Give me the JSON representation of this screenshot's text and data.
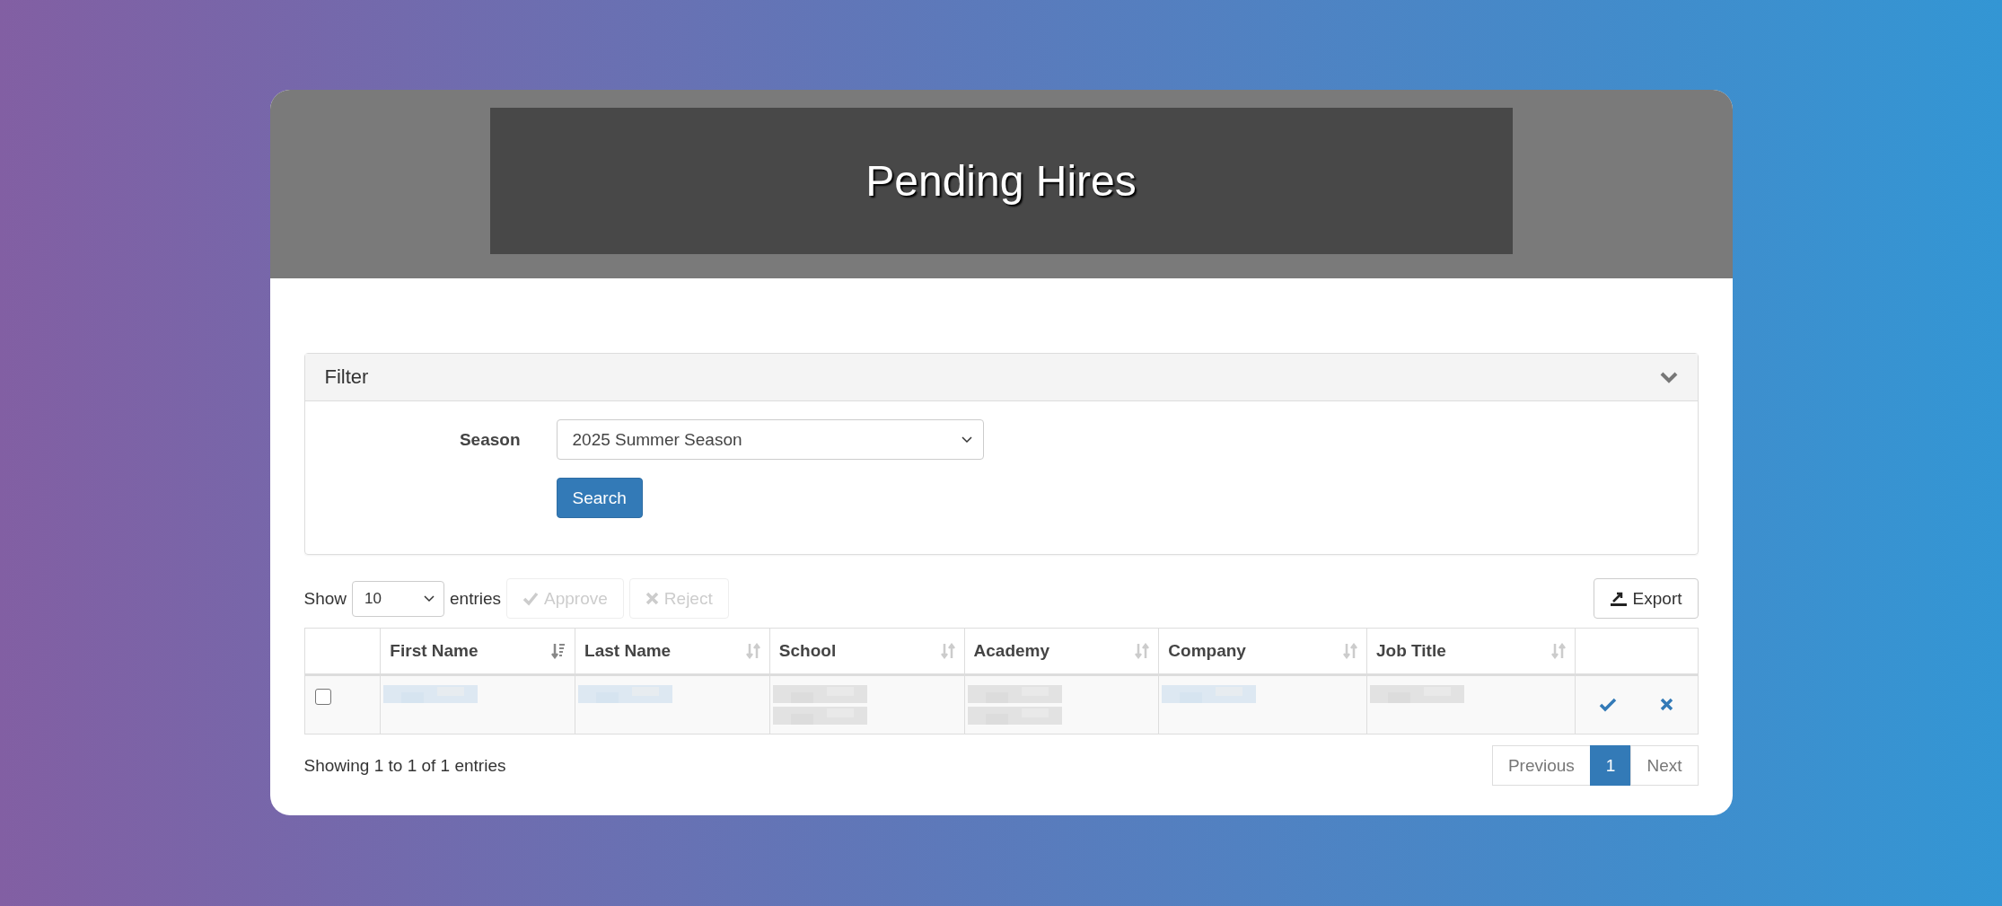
{
  "page": {
    "title": "Pending Hires"
  },
  "filter": {
    "title": "Filter",
    "expanded": true,
    "season_label": "Season",
    "season_value": "2025 Summer Season",
    "search_button": "Search"
  },
  "toolbar": {
    "show_label": "Show",
    "page_size": "10",
    "entries_label": "entries",
    "approve_button": {
      "label": "Approve",
      "disabled": true
    },
    "reject_button": {
      "label": "Reject",
      "disabled": true
    },
    "export_button": "Export"
  },
  "table": {
    "columns": [
      {
        "label": "First Name",
        "sorted": true
      },
      {
        "label": "Last Name",
        "sorted": false
      },
      {
        "label": "School",
        "sorted": false
      },
      {
        "label": "Academy",
        "sorted": false
      },
      {
        "label": "Company",
        "sorted": false
      },
      {
        "label": "Job Title",
        "sorted": false
      }
    ],
    "rows": [
      {
        "checked": false,
        "cells": [
          {
            "kind": "blurred",
            "color": "#d6e4f0"
          },
          {
            "kind": "blurred",
            "color": "#d6e4f0"
          },
          {
            "kind": "blurred",
            "color": "#dcdcdc"
          },
          {
            "kind": "blurred",
            "color": "#dcdcdc"
          },
          {
            "kind": "blurred",
            "color": "#d6e4f0"
          },
          {
            "kind": "blurred",
            "color": "#dcdcdc"
          }
        ]
      }
    ]
  },
  "footer": {
    "info": "Showing 1 to 1 of 1 entries",
    "pages": [
      {
        "label": "Previous",
        "selected": false
      },
      {
        "label": "1",
        "selected": true
      },
      {
        "label": "Next",
        "selected": false
      }
    ]
  }
}
